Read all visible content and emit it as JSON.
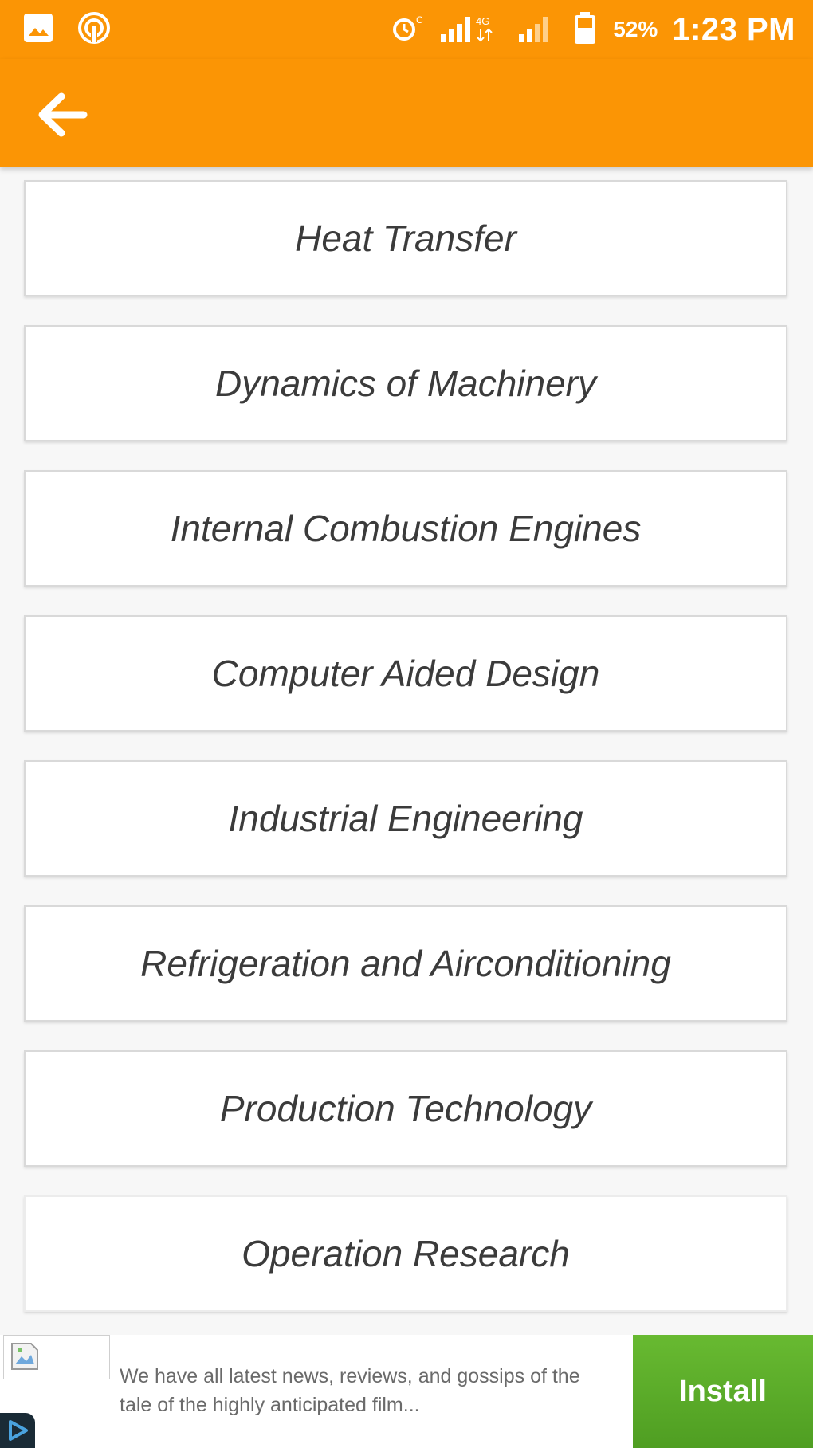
{
  "status_bar": {
    "time": "1:23 PM",
    "battery_percent": "52%",
    "icons": [
      "image-icon",
      "hotspot-icon",
      "alarm-icon",
      "signal-icon",
      "signal-weak-icon",
      "battery-icon"
    ]
  },
  "app_bar": {
    "back_icon": "arrow-left-icon"
  },
  "subjects": [
    {
      "label": "Heat Transfer"
    },
    {
      "label": "Dynamics of Machinery"
    },
    {
      "label": "Internal Combustion Engines"
    },
    {
      "label": "Computer Aided Design"
    },
    {
      "label": "Industrial Engineering"
    },
    {
      "label": "Refrigeration and Airconditioning"
    },
    {
      "label": "Production Technology"
    },
    {
      "label": "Operation Research"
    }
  ],
  "ad": {
    "text": "We have all latest news, reviews, and gossips of the tale of the highly anticipated film...",
    "install_label": "Install"
  },
  "colors": {
    "accent": "#fb9505",
    "install_green": "#5aab28",
    "text": "#3b3b3b"
  }
}
